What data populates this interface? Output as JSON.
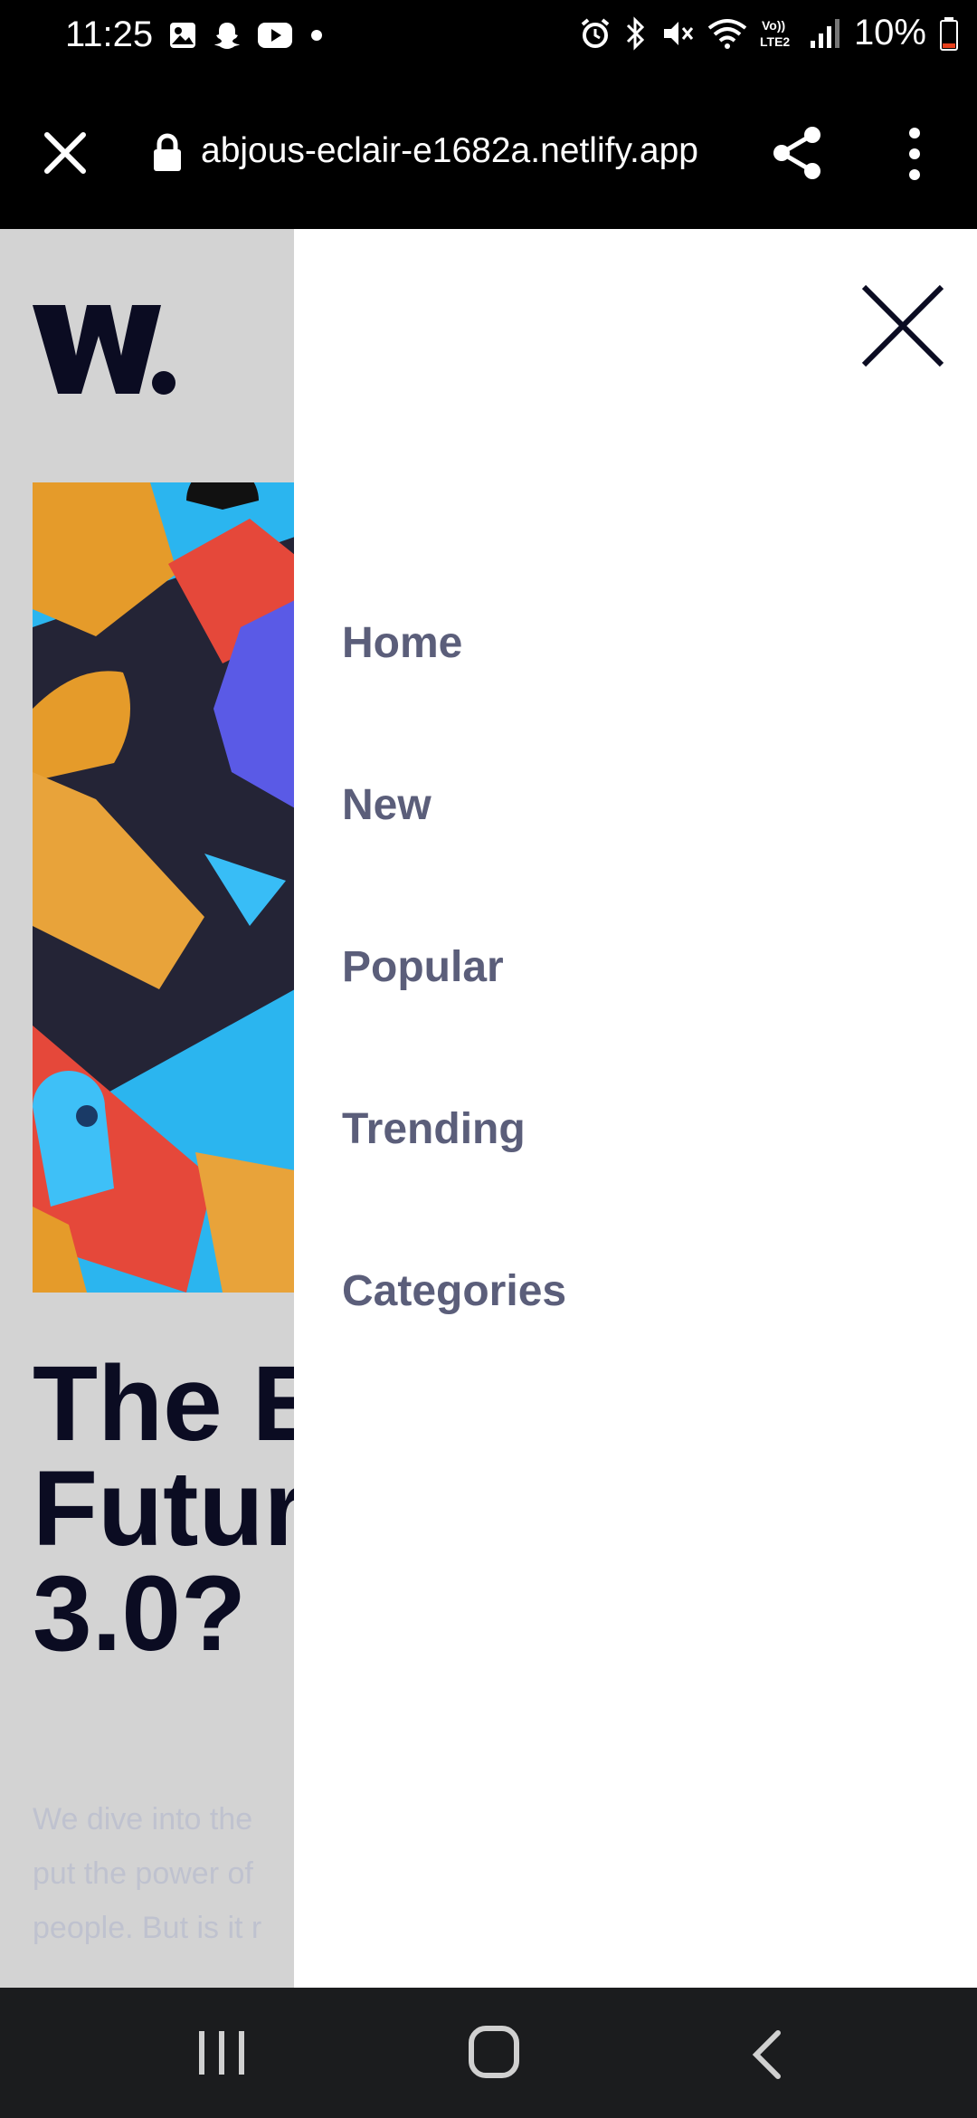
{
  "status_bar": {
    "time": "11:25",
    "battery": "10%",
    "left_icons": [
      "gallery-icon",
      "snapchat-icon",
      "youtube-icon",
      "dot-icon"
    ],
    "right_icons": [
      "alarm-icon",
      "bluetooth-icon",
      "mute-icon",
      "wifi-icon",
      "volte-icon",
      "signal-icon",
      "battery-icon"
    ]
  },
  "browser": {
    "url": "abjous-eclair-e1682a.netlify.app"
  },
  "page": {
    "headline": "The E\nFutur\n3.0?",
    "excerpt": "We dive into the\nput the power of\npeople. But is it r"
  },
  "drawer": {
    "nav_items": [
      "Home",
      "New",
      "Popular",
      "Trending",
      "Categories"
    ]
  },
  "colors": {
    "nav_text": "#5b5e7a",
    "headline": "#0b0c22",
    "overlay": "#d3d3d3",
    "excerpt": "#bfc2cf"
  }
}
